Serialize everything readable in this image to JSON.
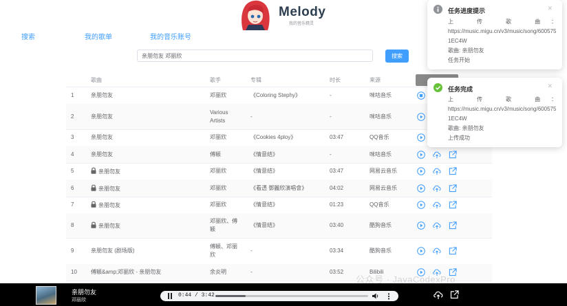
{
  "header": {
    "brand": "Melody",
    "subtitle": "我的音乐精灵"
  },
  "nav": {
    "search": "搜索",
    "my_songs": "我的歌单",
    "my_accounts": "我的音乐账号"
  },
  "search": {
    "value": "亲朋勿友 邓丽欣",
    "button": "搜索"
  },
  "table": {
    "columns": {
      "title": "歌曲",
      "artist": "歌手",
      "album": "专辑",
      "duration": "时长",
      "source": "来源"
    },
    "rows": [
      {
        "index": "1",
        "title": "亲朋勿友",
        "artist": "邓丽欣",
        "album": "《Coloring Stephy》",
        "duration": "-",
        "source": "咪咕音乐",
        "locked": false,
        "alt": false,
        "buttons": "play-stop"
      },
      {
        "index": "2",
        "title": "亲朋勿友",
        "artist": "Various Artists",
        "album": "-",
        "duration": "-",
        "source": "咪咕音乐",
        "locked": false,
        "alt": true,
        "buttons": "play"
      },
      {
        "index": "3",
        "title": "亲朋勿友",
        "artist": "邓丽欣",
        "album": "《Cookies 4ploy》",
        "duration": "03:47",
        "source": "QQ音乐",
        "locked": false,
        "alt": false,
        "buttons": "play"
      },
      {
        "index": "4",
        "title": "亲朋勿友",
        "artist": "傅颖",
        "album": "《情意结》",
        "duration": "-",
        "source": "咪咕音乐",
        "locked": false,
        "alt": true,
        "buttons": "all"
      },
      {
        "index": "5",
        "title": "亲朋勿友",
        "artist": "邓丽欣",
        "album": "《情意结》",
        "duration": "03:47",
        "source": "网易云音乐",
        "locked": true,
        "alt": false,
        "buttons": "all"
      },
      {
        "index": "6",
        "title": "亲朋勿友",
        "artist": "邓丽欣",
        "album": "《看透 鄧麗欣演唱會》",
        "duration": "04:02",
        "source": "网易云音乐",
        "locked": true,
        "alt": true,
        "buttons": "all"
      },
      {
        "index": "7",
        "title": "亲朋勿友",
        "artist": "邓丽欣",
        "album": "《情意结》",
        "duration": "01:23",
        "source": "QQ音乐",
        "locked": true,
        "alt": false,
        "buttons": "all"
      },
      {
        "index": "8",
        "title": "亲朋勿友",
        "artist": "邓丽欣、傅颖",
        "album": "《情意结》",
        "duration": "03:40",
        "source": "酷狗音乐",
        "locked": true,
        "alt": true,
        "buttons": "all"
      },
      {
        "index": "9",
        "title": "亲朋勿友 (剧场版)",
        "artist": "傅颖、邓丽欣",
        "album": "-",
        "duration": "03:34",
        "source": "酷狗音乐",
        "locked": false,
        "alt": false,
        "buttons": "all"
      },
      {
        "index": "10",
        "title": "傅颖&amp;邓丽欣 - 亲朋勿友",
        "artist": "余炎明",
        "album": "-",
        "duration": "03:52",
        "source": "Bilibili",
        "locked": false,
        "alt": true,
        "buttons": "all"
      }
    ]
  },
  "notifications": [
    {
      "type": "info",
      "title": "任务进度提示",
      "lines": [
        "上 传 歌 曲：",
        "https://music.migu.cn/v3/music/song/6005751EC4W",
        "歌曲: 亲朋勿友",
        "任务开始"
      ]
    },
    {
      "type": "success",
      "title": "任务完成",
      "lines": [
        "上 传 歌 曲：",
        "https://music.migu.cn/v3/music/song/6005751EC4W",
        "歌曲: 亲朋勿友",
        "上传成功"
      ]
    }
  ],
  "player": {
    "title": "亲朋勿友",
    "artist": "邓丽欣",
    "time": "0:44 / 3:42",
    "progress": 0.198
  },
  "watermark": "公众号 · JavaCodexPro",
  "colors": {
    "accent": "#409eff",
    "success": "#67c23a",
    "info": "#909399",
    "player_bg": "#000000"
  }
}
